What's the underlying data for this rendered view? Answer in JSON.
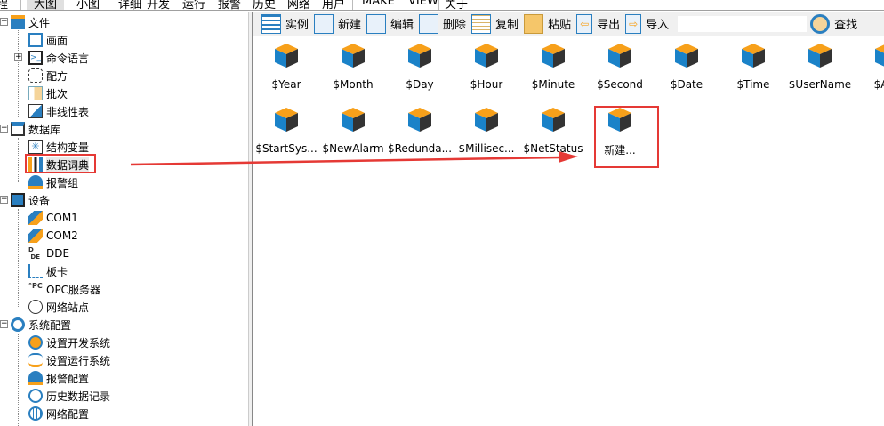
{
  "menu": [
    "程",
    "大图",
    "小图",
    "详细",
    "开发",
    "运行",
    "报警",
    "历史",
    "网络",
    "用户",
    "MAKE",
    "VIEW",
    "关于"
  ],
  "toolbar": {
    "instance": "实例",
    "new": "新建",
    "edit": "编辑",
    "delete": "删除",
    "copy": "复制",
    "paste": "粘贴",
    "export": "导出",
    "import": "导入",
    "search_value": "",
    "find": "查找"
  },
  "tree": {
    "file": "文件",
    "screen": "画面",
    "cmd": "命令语言",
    "recipe": "配方",
    "batch": "批次",
    "nonlinear": "非线性表",
    "db": "数据库",
    "struct": "结构变量",
    "dict": "数据词典",
    "alarmgroup": "报警组",
    "device": "设备",
    "com1": "COM1",
    "com2": "COM2",
    "dde": "DDE",
    "board": "板卡",
    "opc": "OPC服务器",
    "netsite": "网络站点",
    "sysconf": "系统配置",
    "devsys": "设置开发系统",
    "runsys": "设置运行系统",
    "alarmconf": "报警配置",
    "histrec": "历史数据记录",
    "netconf": "网络配置"
  },
  "items": [
    "$Year",
    "$Month",
    "$Day",
    "$Hour",
    "$Minute",
    "$Second",
    "$Date",
    "$Time",
    "$UserName",
    "$Acc",
    "$StartSys...",
    "$NewAlarm",
    "$Redunda...",
    "$Millisec...",
    "$NetStatus",
    "新建..."
  ],
  "colors": {
    "highlight": "#e53935",
    "cube_top": "#f7a01a",
    "cube_left": "#1a82c8",
    "cube_right": "#333333"
  }
}
